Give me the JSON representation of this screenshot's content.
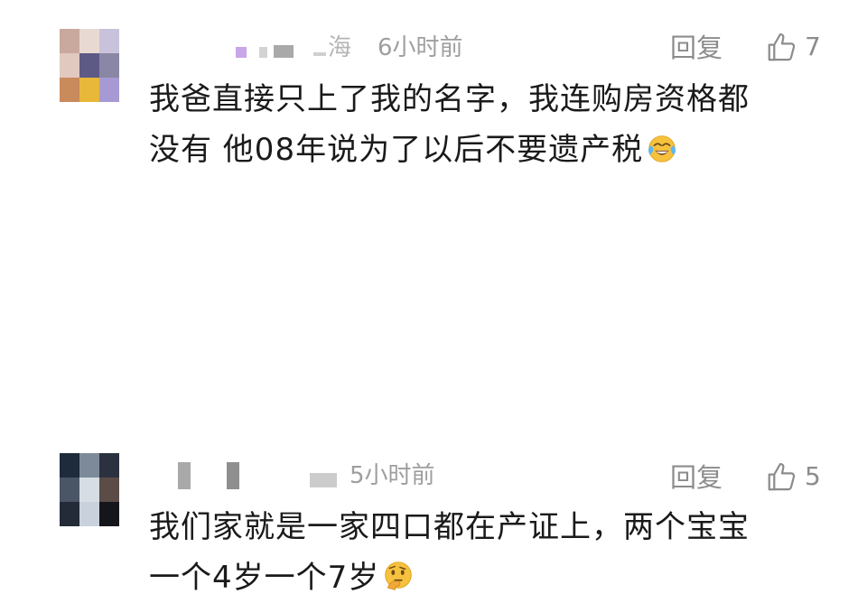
{
  "comments": [
    {
      "location_fragment": "海",
      "time": "6小时前",
      "reply_label": "回复",
      "like_count": "7",
      "text_lines": [
        "我爸直接只上了我的名字，我连购房资格都",
        "没有  他08年说为了以后不要遗产税"
      ],
      "emoji": "crying-laughing-emoji",
      "avatar_colors": [
        "#c9a89d",
        "#e9d9d3",
        "#c9c2dc",
        "#e2c9bf",
        "#5e5a86",
        "#8a86a5",
        "#c98a5c",
        "#e8b83a",
        "#a79ad4"
      ]
    },
    {
      "time": "5小时前",
      "reply_label": "回复",
      "like_count": "5",
      "text_lines": [
        "我们家就是一家四口都在产证上，两个宝宝",
        "一个4岁一个7岁"
      ],
      "emoji": "thinking-face-emoji",
      "avatar_colors": [
        "#1e2b3c",
        "#7d8a99",
        "#2c3140",
        "#4a5566",
        "#d6dde4",
        "#5b4c48",
        "#232b38",
        "#c9d2dc",
        "#15161b"
      ]
    }
  ],
  "colors": {
    "secondary_text": "#9e9e9e",
    "body_text": "#1a1a1a",
    "action_text": "#8c8c8c"
  }
}
